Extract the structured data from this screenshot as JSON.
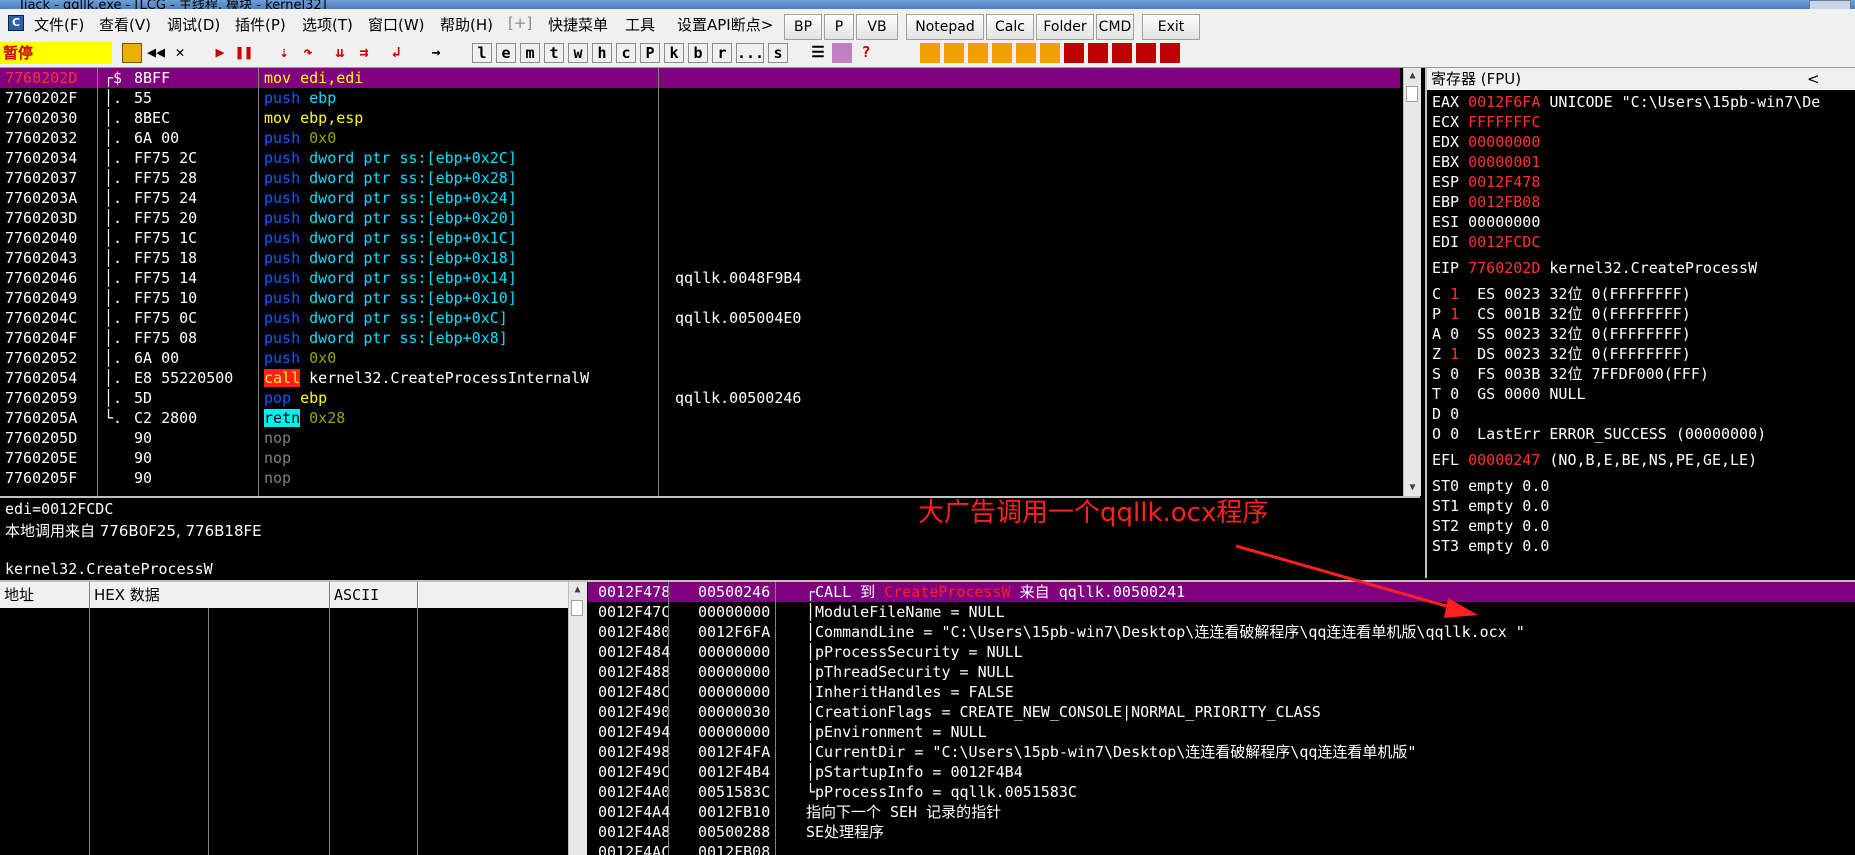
{
  "title_bar": {
    "text": "Jiack - qqllk.exe - [LCG - 主线程, 模块 - kernel32]"
  },
  "menu": {
    "items": [
      "文件(F)",
      "查看(V)",
      "调试(D)",
      "插件(P)",
      "选项(T)",
      "窗口(W)",
      "帮助(H)",
      "[+]",
      "快捷菜单",
      "工具",
      "设置API断点>"
    ],
    "quick_buttons": [
      "BP",
      "P",
      "VB",
      "Notepad",
      "Calc",
      "Folder",
      "CMD",
      "Exit"
    ]
  },
  "toolbar": {
    "status": "暂停",
    "letters": [
      "l",
      "e",
      "m",
      "t",
      "w",
      "h",
      "c",
      "P",
      "k",
      "b",
      "r",
      "...",
      "s"
    ]
  },
  "cpu": {
    "rows": [
      {
        "addr": "7760202D",
        "mark": "┌$",
        "hex": "8BFF",
        "op": "mov",
        "args": "edi,edi",
        "comment": ""
      },
      {
        "addr": "7760202F",
        "mark": "│.",
        "hex": "55",
        "op": "push",
        "args": "ebp",
        "comment": ""
      },
      {
        "addr": "77602030",
        "mark": "│.",
        "hex": "8BEC",
        "op": "mov",
        "args": "ebp,esp",
        "comment": ""
      },
      {
        "addr": "77602032",
        "mark": "│.",
        "hex": "6A 00",
        "op": "push",
        "args": "0x0",
        "comment": ""
      },
      {
        "addr": "77602034",
        "mark": "│.",
        "hex": "FF75 2C",
        "op": "push",
        "args": "dword ptr ss:[ebp+0x2C]",
        "comment": ""
      },
      {
        "addr": "77602037",
        "mark": "│.",
        "hex": "FF75 28",
        "op": "push",
        "args": "dword ptr ss:[ebp+0x28]",
        "comment": ""
      },
      {
        "addr": "7760203A",
        "mark": "│.",
        "hex": "FF75 24",
        "op": "push",
        "args": "dword ptr ss:[ebp+0x24]",
        "comment": ""
      },
      {
        "addr": "7760203D",
        "mark": "│.",
        "hex": "FF75 20",
        "op": "push",
        "args": "dword ptr ss:[ebp+0x20]",
        "comment": ""
      },
      {
        "addr": "77602040",
        "mark": "│.",
        "hex": "FF75 1C",
        "op": "push",
        "args": "dword ptr ss:[ebp+0x1C]",
        "comment": ""
      },
      {
        "addr": "77602043",
        "mark": "│.",
        "hex": "FF75 18",
        "op": "push",
        "args": "dword ptr ss:[ebp+0x18]",
        "comment": ""
      },
      {
        "addr": "77602046",
        "mark": "│.",
        "hex": "FF75 14",
        "op": "push",
        "args": "dword ptr ss:[ebp+0x14]",
        "comment": "qqllk.0048F9B4"
      },
      {
        "addr": "77602049",
        "mark": "│.",
        "hex": "FF75 10",
        "op": "push",
        "args": "dword ptr ss:[ebp+0x10]",
        "comment": ""
      },
      {
        "addr": "7760204C",
        "mark": "│.",
        "hex": "FF75 0C",
        "op": "push",
        "args": "dword ptr ss:[ebp+0xC]",
        "comment": "qqllk.005004E0"
      },
      {
        "addr": "7760204F",
        "mark": "│.",
        "hex": "FF75 08",
        "op": "push",
        "args": "dword ptr ss:[ebp+0x8]",
        "comment": ""
      },
      {
        "addr": "77602052",
        "mark": "│.",
        "hex": "6A 00",
        "op": "push",
        "args": "0x0",
        "comment": ""
      },
      {
        "addr": "77602054",
        "mark": "│.",
        "hex": "E8 55220500",
        "op": "call",
        "args": "kernel32.CreateProcessInternalW",
        "comment": ""
      },
      {
        "addr": "77602059",
        "mark": "│.",
        "hex": "5D",
        "op": "pop",
        "args": "ebp",
        "comment": "qqllk.00500246"
      },
      {
        "addr": "7760205A",
        "mark": "└.",
        "hex": "C2 2800",
        "op": "retn",
        "args": "0x28",
        "comment": ""
      },
      {
        "addr": "7760205D",
        "mark": "",
        "hex": "90",
        "op": "nop",
        "args": "",
        "comment": ""
      },
      {
        "addr": "7760205E",
        "mark": "",
        "hex": "90",
        "op": "nop",
        "args": "",
        "comment": ""
      },
      {
        "addr": "7760205F",
        "mark": "",
        "hex": "90",
        "op": "nop",
        "args": "",
        "comment": ""
      }
    ]
  },
  "info": {
    "line1": "edi=0012FCDC",
    "line2": "本地调用来自 776B0F25, 776B18FE",
    "line3": "kernel32.CreateProcessW"
  },
  "registers": {
    "header": "寄存器 (FPU)",
    "header_arrow": "<",
    "gp": [
      {
        "name": "EAX",
        "value": "0012F6FA",
        "note": "UNICODE \"C:\\Users\\15pb-win7\\De",
        "changed": true
      },
      {
        "name": "ECX",
        "value": "FFFFFFFC",
        "note": "",
        "changed": true
      },
      {
        "name": "EDX",
        "value": "00000000",
        "note": "",
        "changed": true
      },
      {
        "name": "EBX",
        "value": "00000001",
        "note": "",
        "changed": true
      },
      {
        "name": "ESP",
        "value": "0012F478",
        "note": "",
        "changed": true
      },
      {
        "name": "EBP",
        "value": "0012FB08",
        "note": "",
        "changed": true
      },
      {
        "name": "ESI",
        "value": "00000000",
        "note": "",
        "changed": false
      },
      {
        "name": "EDI",
        "value": "0012FCDC",
        "note": "",
        "changed": true
      }
    ],
    "eip": {
      "name": "EIP",
      "value": "7760202D",
      "note": "kernel32.CreateProcessW"
    },
    "flags": [
      {
        "f": "C",
        "v": "1",
        "seg": "ES 0023 32位 0(FFFFFFFF)",
        "changed": true
      },
      {
        "f": "P",
        "v": "1",
        "seg": "CS 001B 32位 0(FFFFFFFF)",
        "changed": true
      },
      {
        "f": "A",
        "v": "0",
        "seg": "SS 0023 32位 0(FFFFFFFF)",
        "changed": false
      },
      {
        "f": "Z",
        "v": "1",
        "seg": "DS 0023 32位 0(FFFFFFFF)",
        "changed": true
      },
      {
        "f": "S",
        "v": "0",
        "seg": "FS 003B 32位 7FFDF000(FFF)",
        "changed": false
      },
      {
        "f": "T",
        "v": "0",
        "seg": "GS 0000 NULL",
        "changed": false
      },
      {
        "f": "D",
        "v": "0",
        "seg": "",
        "changed": false
      },
      {
        "f": "O",
        "v": "0",
        "seg": "LastErr ERROR_SUCCESS (00000000)",
        "changed": false
      }
    ],
    "efl": {
      "name": "EFL",
      "value": "00000247",
      "note": "(NO,B,E,BE,NS,PE,GE,LE)"
    },
    "fpu": [
      "ST0 empty 0.0",
      "ST1 empty 0.0",
      "ST2 empty 0.0",
      "ST3 empty 0.0"
    ]
  },
  "dump": {
    "headers": [
      "地址",
      "HEX 数据",
      "ASCII"
    ]
  },
  "stack": {
    "rows": [
      {
        "addr": "0012F478",
        "val": "00500246",
        "pre": "┌CALL 到 ",
        "red": "CreateProcessW",
        "post": " 来自 qqllk.00500241"
      },
      {
        "addr": "0012F47C",
        "val": "00000000",
        "pre": "│ModuleFileName = NULL",
        "red": "",
        "post": ""
      },
      {
        "addr": "0012F480",
        "val": "0012F6FA",
        "pre": "│CommandLine = \"C:\\Users\\15pb-win7\\Desktop\\连连看破解程序\\qq连连看单机版\\qqllk.ocx \"",
        "red": "",
        "post": ""
      },
      {
        "addr": "0012F484",
        "val": "00000000",
        "pre": "│pProcessSecurity = NULL",
        "red": "",
        "post": ""
      },
      {
        "addr": "0012F488",
        "val": "00000000",
        "pre": "│pThreadSecurity = NULL",
        "red": "",
        "post": ""
      },
      {
        "addr": "0012F48C",
        "val": "00000000",
        "pre": "│InheritHandles = FALSE",
        "red": "",
        "post": ""
      },
      {
        "addr": "0012F490",
        "val": "00000030",
        "pre": "│CreationFlags = CREATE_NEW_CONSOLE|NORMAL_PRIORITY_CLASS",
        "red": "",
        "post": ""
      },
      {
        "addr": "0012F494",
        "val": "00000000",
        "pre": "│pEnvironment = NULL",
        "red": "",
        "post": ""
      },
      {
        "addr": "0012F498",
        "val": "0012F4FA",
        "pre": "│CurrentDir = \"C:\\Users\\15pb-win7\\Desktop\\连连看破解程序\\qq连连看单机版\"",
        "red": "",
        "post": ""
      },
      {
        "addr": "0012F49C",
        "val": "0012F4B4",
        "pre": "│pStartupInfo = 0012F4B4",
        "red": "",
        "post": ""
      },
      {
        "addr": "0012F4A0",
        "val": "0051583C",
        "pre": "└pProcessInfo = qqllk.0051583C",
        "red": "",
        "post": ""
      },
      {
        "addr": "0012F4A4",
        "val": "0012FB10",
        "pre": "指向下一个 SEH 记录的指针",
        "red": "",
        "post": ""
      },
      {
        "addr": "0012F4A8",
        "val": "00500288",
        "pre": "SE处理程序",
        "red": "",
        "post": ""
      },
      {
        "addr": "0012F4AC",
        "val": "0012FB08",
        "pre": "",
        "red": "",
        "post": ""
      }
    ]
  },
  "annotation": {
    "text": "大广告调用一个qqllk.ocx程序",
    "color": "#ff2020"
  }
}
